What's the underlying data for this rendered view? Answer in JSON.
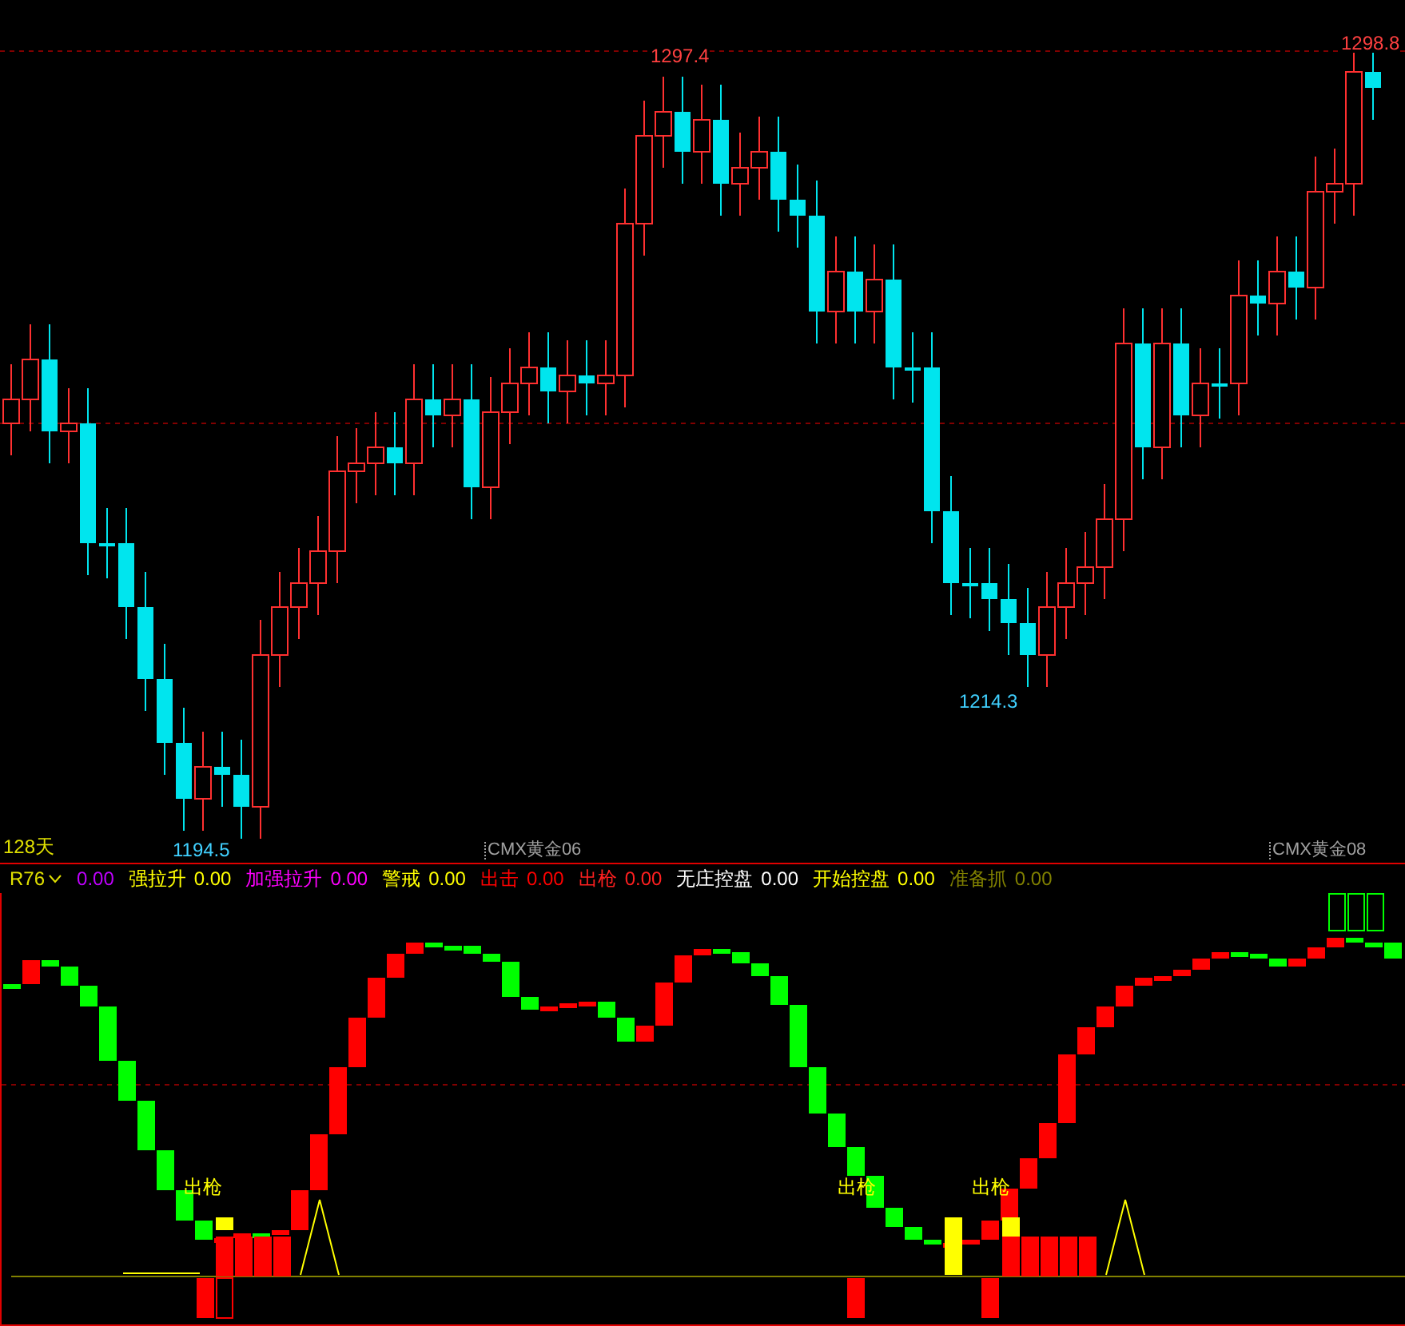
{
  "price_chart": {
    "labels": [
      {
        "text": "1297.4",
        "kind": "high"
      },
      {
        "text": "1298.8",
        "kind": "high"
      },
      {
        "text": "1214.3",
        "kind": "low"
      },
      {
        "text": "1194.5",
        "kind": "low"
      }
    ],
    "period": "128天",
    "contracts": [
      "CMX黄金06",
      "CMX黄金08"
    ]
  },
  "indicator": {
    "name": "R76",
    "items": [
      {
        "value": "0.00",
        "color": "#c000ff"
      },
      {
        "label": "强拉升",
        "value": "0.00",
        "color": "#ffff00"
      },
      {
        "label": "加强拉升",
        "value": "0.00",
        "color": "#ff00ff"
      },
      {
        "label": "警戒",
        "value": "0.00",
        "color": "#ffff00"
      },
      {
        "label": "出击",
        "value": "0.00",
        "color": "#ff0000"
      },
      {
        "label": "出枪",
        "value": "0.00",
        "color": "#ff2020"
      },
      {
        "label": "无庄控盘",
        "value": "0.00",
        "color": "#ffffff"
      },
      {
        "label": "开始控盘",
        "value": "0.00",
        "color": "#ffff00"
      },
      {
        "label": "准备抓",
        "value": "0.00",
        "color": "#808000"
      }
    ],
    "signals": [
      "出枪",
      "出枪",
      "出枪"
    ]
  }
}
